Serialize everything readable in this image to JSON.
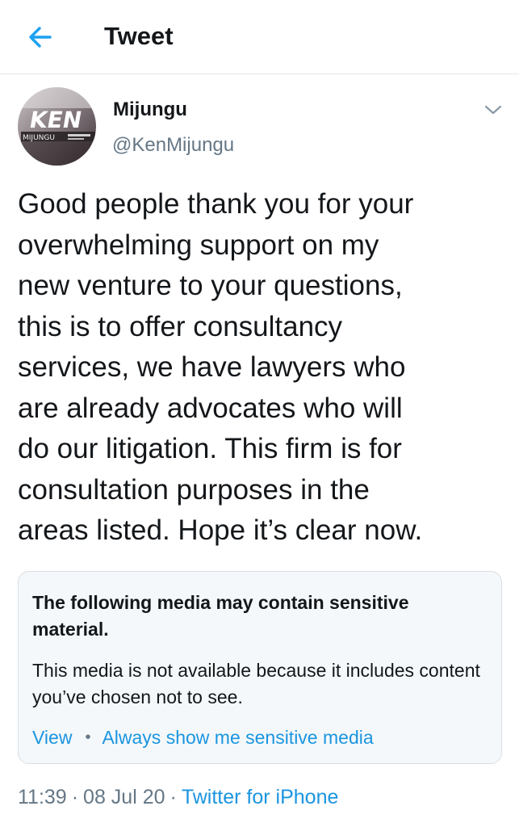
{
  "header": {
    "title": "Tweet",
    "back_icon": "arrow-left-icon",
    "accent": "#1da1f2"
  },
  "tweet": {
    "author": {
      "name": "Mijungu",
      "handle": "@KenMijungu",
      "avatar_text": "KEN",
      "avatar_subtext": "MIJUNGU"
    },
    "text": "Good people thank you for your\noverwhelming support on my\nnew venture to your questions,\nthis is to offer consultancy\nservices, we have lawyers who\nare already advocates who will\ndo our litigation. This firm is for\nconsultation purposes in the\nareas listed. Hope it’s clear now.",
    "sensitive": {
      "title": "The following media may contain sensitive material.",
      "body": "This media is not available because it includes content you’ve chosen not to see.",
      "view_label": "View",
      "always_label": "Always show me sensitive media"
    },
    "time": "11:39",
    "date": "08 Jul 20",
    "source": "Twitter for iPhone"
  },
  "colors": {
    "link": "#1b95e0",
    "secondary_text": "#657786",
    "primary_text": "#14171a",
    "card_bg": "#f5f8fa",
    "border": "#e1e8ed"
  }
}
